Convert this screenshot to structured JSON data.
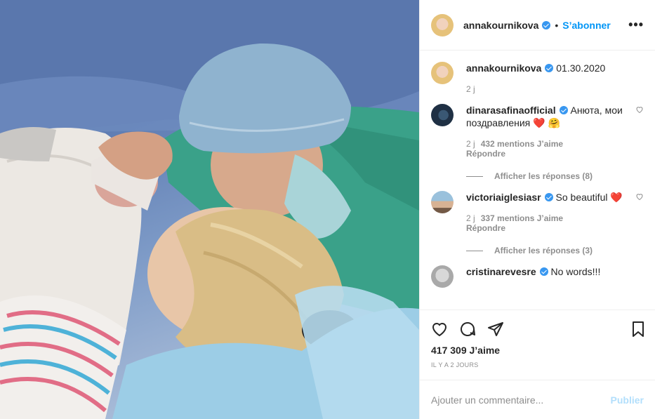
{
  "post": {
    "author": "annakournikova",
    "follow_label": "S’abonner",
    "separator": "•",
    "more_label": "•••",
    "caption": "01.30.2020",
    "caption_age": "2 j"
  },
  "comments": [
    {
      "user": "dinarasafinaofficial",
      "text": "Анюта, мои поздравления ❤️ 🤗",
      "age": "2 j",
      "likes": "432 mentions J’aime",
      "reply": "Répondre",
      "show_replies": "Afficher les réponses (8)"
    },
    {
      "user": "victoriaiglesiasr",
      "text": "So beautiful ❤️",
      "age": "2 j",
      "likes": "337 mentions J’aime",
      "reply": "Répondre",
      "show_replies": "Afficher les réponses (3)"
    },
    {
      "user": "cristinarevesre",
      "text": "No words!!!"
    }
  ],
  "stats": {
    "likes": "417 309 J’aime",
    "posted": "IL Y A 2 JOURS"
  },
  "composer": {
    "placeholder": "Ajouter un commentaire...",
    "publish": "Publier"
  },
  "colors": {
    "accent": "#0095f6",
    "heart": "#ed4956",
    "muted": "#8e8e8e"
  }
}
